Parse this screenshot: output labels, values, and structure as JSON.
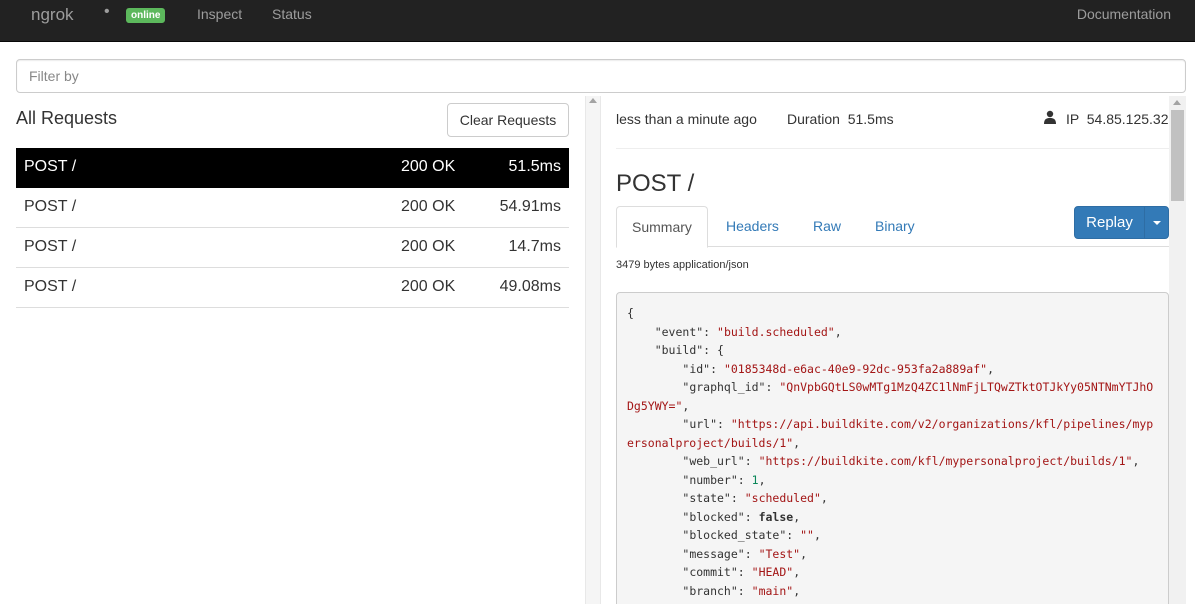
{
  "navbar": {
    "brand": "ngrok",
    "dot": "•",
    "status_badge": "online",
    "links": {
      "inspect": "Inspect",
      "status": "Status",
      "documentation": "Documentation"
    }
  },
  "filter": {
    "placeholder": "Filter by"
  },
  "requests_panel": {
    "title": "All Requests",
    "clear_button": "Clear Requests",
    "items": [
      {
        "method": "POST /",
        "status": "200 OK",
        "duration": "51.5ms",
        "selected": true
      },
      {
        "method": "POST /",
        "status": "200 OK",
        "duration": "54.91ms"
      },
      {
        "method": "POST /",
        "status": "200 OK",
        "duration": "14.7ms"
      },
      {
        "method": "POST /",
        "status": "200 OK",
        "duration": "49.08ms"
      }
    ]
  },
  "detail": {
    "time_ago": "less than a minute ago",
    "duration": "Duration  51.5ms",
    "ip": "IP  54.85.125.32",
    "title": "POST /",
    "tabs": {
      "summary": "Summary",
      "headers": "Headers",
      "raw": "Raw",
      "binary": "Binary"
    },
    "replay_button": "Replay",
    "content_meta": "3479 bytes application/json",
    "json_lines": {
      "l01": "{",
      "k02": "\"event\"",
      "v02": "\"build.scheduled\"",
      "k03": "\"build\"",
      "v03": "{",
      "k04": "\"id\"",
      "v04": "\"0185348d-e6ac-40e9-92dc-953fa2a889af\"",
      "k05": "\"graphql_id\"",
      "v05": "\"QnVpbGQtLS0wMTg1MzQ4ZC1lNmFjLTQwZTktOTJkYy05NTNmYTJhODg5YWY=\"",
      "k06": "\"url\"",
      "v06": "\"https://api.buildkite.com/v2/organizations/kfl/pipelines/mypersonalproject/builds/1\"",
      "k07": "\"web_url\"",
      "v07": "\"https://buildkite.com/kfl/mypersonalproject/builds/1\"",
      "k08": "\"number\"",
      "v08": "1",
      "k09": "\"state\"",
      "v09": "\"scheduled\"",
      "k10": "\"blocked\"",
      "v10": "false",
      "k11": "\"blocked_state\"",
      "v11": "\"\"",
      "k12": "\"message\"",
      "v12": "\"Test\"",
      "k13": "\"commit\"",
      "v13": "\"HEAD\"",
      "k14": "\"branch\"",
      "v14": "\"main\""
    }
  },
  "colors": {
    "navbar_bg": "#222222",
    "badge_green": "#5cb85c",
    "primary_blue": "#337ab7",
    "selected_row_bg": "#000000",
    "json_string": "#a31515",
    "json_number": "#098658"
  },
  "icons": {
    "user": "user-icon",
    "caret": "caret-down-icon",
    "scroll_up": "chevron-up-icon"
  }
}
